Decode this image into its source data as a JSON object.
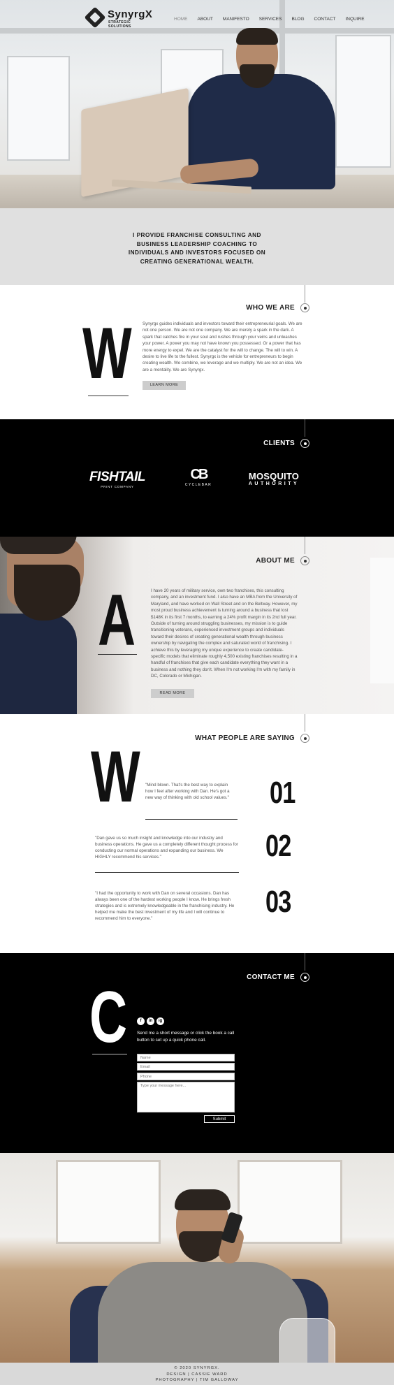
{
  "brand": {
    "name": "SynyrgX",
    "tagline": "STRATEGIC SOLUTIONS"
  },
  "nav": {
    "items": [
      "HOME",
      "ABOUT",
      "MANIFESTO",
      "SERVICES",
      "BLOG",
      "CONTACT",
      "INQUIRE"
    ],
    "active": "HOME"
  },
  "intro": {
    "text": "I PROVIDE FRANCHISE CONSULTING AND BUSINESS LEADERSHIP COACHING TO INDIVIDUALS AND INVESTORS FOCUSED ON CREATING GENERATIONAL WEALTH."
  },
  "who": {
    "heading": "WHO WE ARE",
    "letter": "W",
    "body": "Synyrgx guides individuals and investors toward their entrepreneurial goals. We are not one person. We are not one company. We are merely a spark in the dark. A spark that catches fire in your soul and rushes through your veins and unleashes your power. A power you may not have known you possessed. Or a power that has more energy to expel. We are the catalyst for the will to change. The will to win. A desire to live life to the fullest. Synyrgx is the vehicle for entrepreneurs to begin creating wealth. We combine, we leverage and we multiply. We are not an idea. We are a mentality. We are Synyrgx.",
    "button": "LEARN MORE"
  },
  "clients": {
    "heading": "CLIENTS",
    "logos": [
      {
        "name": "FISHTAIL",
        "sub": "PRINT COMPANY"
      },
      {
        "name": "CB",
        "sub": "CYCLEBAR"
      },
      {
        "name": "MOSQUITO",
        "sub": "AUTHORITY"
      }
    ]
  },
  "about": {
    "heading": "ABOUT ME",
    "letter": "A",
    "body": "I have 20 years of military service, own two franchises, this consulting company, and an investment fund. I also have an MBA from the University of Maryland, and have worked on Wall Street and on the Beltway. However, my most proud business achievement is turning around a business that lost $148K in its first 7 months, to earning a 24% profit margin in its 2nd full year. Outside of turning around struggling businesses, my mission is to guide transitioning veterans, experienced investment groups and individuals toward their desires of creating generational wealth through business ownership by navigating the complex and saturated world of franchising. I achieve this by leveraging my unique experience to create candidate-specific models that eliminate roughly 4,500 existing franchises resulting in a handful of franchises that give each candidate everything they want in a business and nothing they don't. When I'm not working I'm with my family in DC, Colorado or Michigan.",
    "button": "READ MORE"
  },
  "testimonials": {
    "heading": "WHAT PEOPLE ARE SAYING",
    "letter": "W",
    "items": [
      {
        "num": "01",
        "quote": "\"Mind blown. That's the best way to explain how I feel after working with Dan. He's got a new way of thinking with old school values.\""
      },
      {
        "num": "02",
        "quote": "\"Dan gave us so much insight and knowledge into our industry and business operations. He gave us a completely different thought process for conducting our normal operations and expanding our business. We HIGHLY recommend his services.\""
      },
      {
        "num": "03",
        "quote": "\"I had the opportunity to work with Dan on several occasions. Dan has always been one of the hardest working people I know. He brings fresh strategies and is extremely knowledgeable in the franchising industry. He helped me make the best investment of my life and I will continue to recommend him to everyone.\""
      }
    ]
  },
  "contact": {
    "heading": "CONTACT ME",
    "letter": "C",
    "social": [
      "f",
      "in",
      "ig"
    ],
    "text": "Send me a short message or click the book a call button to set up a quick phone call.",
    "fields": {
      "name": "Name",
      "email": "Email",
      "phone": "Phone",
      "message": "Type your message here..."
    },
    "submit": "Submit"
  },
  "footer": {
    "lines": [
      "© 2020 SYNYRGX.",
      "DESIGN | CASSIE WARD",
      "PHOTOGRAPHY | TIM GALLOWAY"
    ]
  }
}
